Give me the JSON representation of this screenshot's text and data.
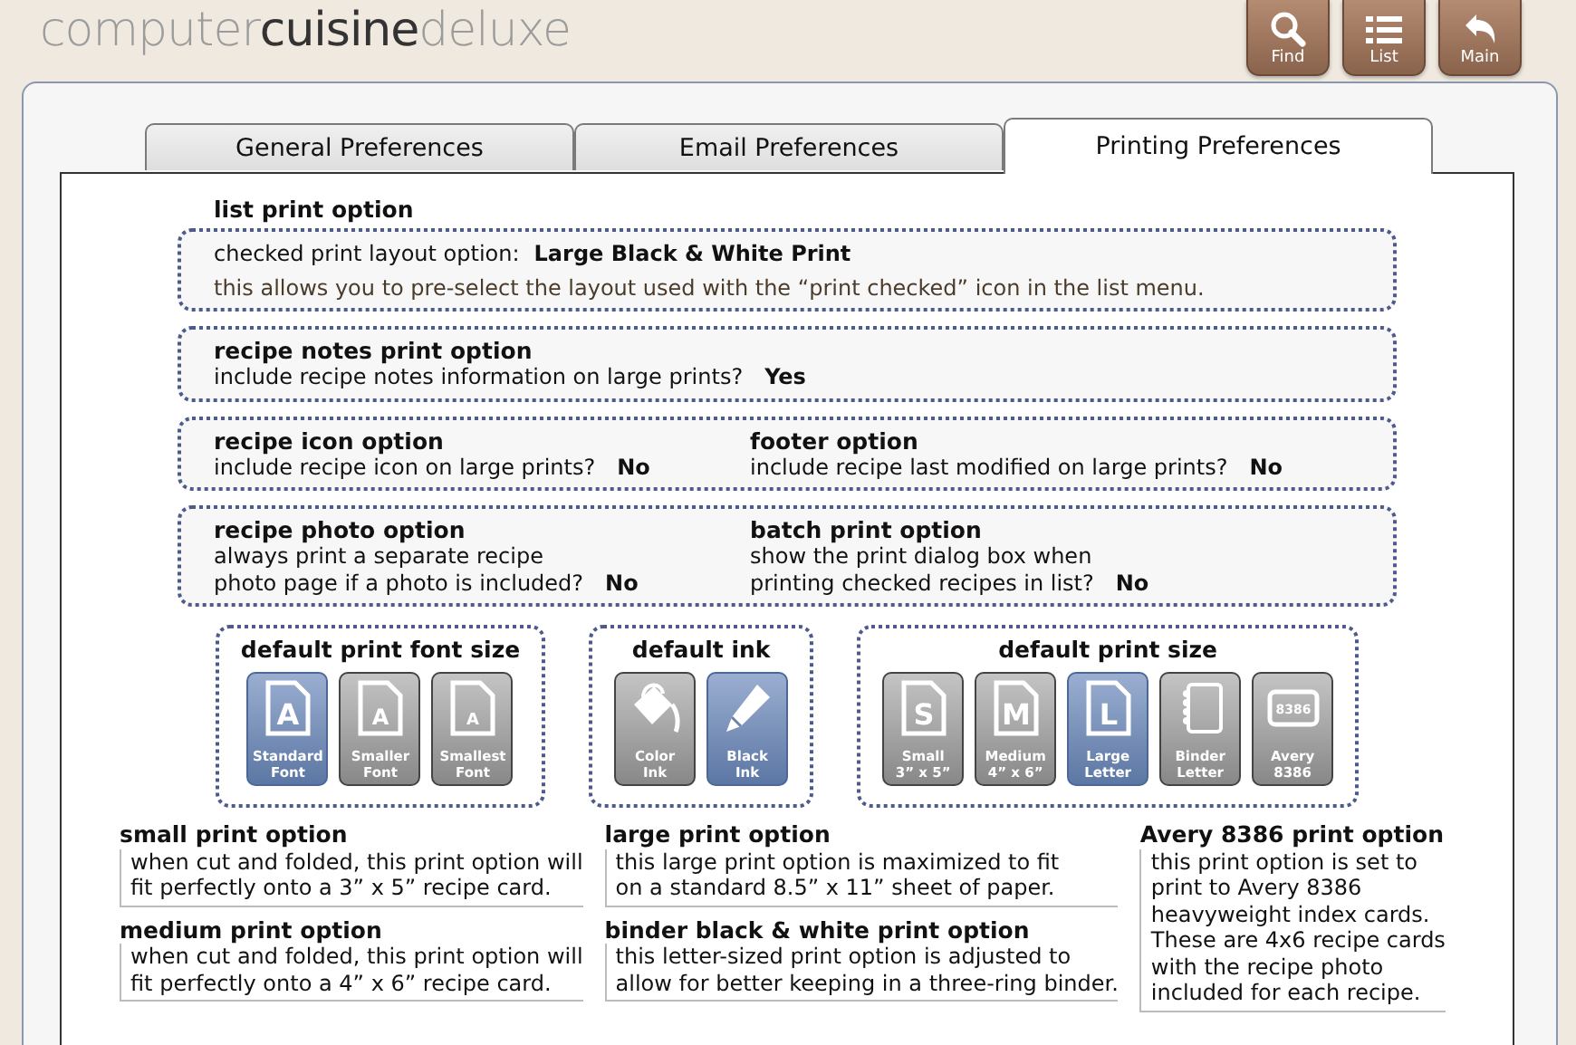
{
  "logo": {
    "part_1": "computer",
    "part_2": "cuisine",
    "part_3": "deluxe"
  },
  "toolbar": [
    {
      "label": "Find",
      "kind": "search"
    },
    {
      "label": "List",
      "kind": "list"
    },
    {
      "label": "Main",
      "kind": "back"
    }
  ],
  "tabs": [
    {
      "label": "General Preferences",
      "selected": false
    },
    {
      "label": "Email Preferences",
      "selected": false
    },
    {
      "label": "Printing Preferences",
      "selected": true
    }
  ],
  "list_print_option": {
    "title": "list print option",
    "setting_label": "checked print layout option:",
    "setting_value": "Large Black & White Print",
    "note": "this allows you to pre-select the layout used with the “print checked” icon in the list menu."
  },
  "option_groups": [
    {
      "options": [
        {
          "title": "recipe notes print option",
          "lines": [
            "include recipe notes information on large prints?"
          ],
          "value": "Yes"
        }
      ]
    },
    {
      "options": [
        {
          "title": "recipe icon option",
          "lines": [
            "include recipe icon on large prints?"
          ],
          "value": "No"
        },
        {
          "title": "footer option",
          "lines": [
            "include recipe last modified on large prints?"
          ],
          "value": "No"
        }
      ]
    },
    {
      "options": [
        {
          "title": "recipe photo option",
          "lines": [
            "always print a separate recipe",
            "photo page if a photo is included?"
          ],
          "value": "No"
        },
        {
          "title": "batch print option",
          "lines": [
            "show the print dialog box when",
            "printing checked recipes in list?"
          ],
          "value": "No"
        }
      ]
    }
  ],
  "choice_groups": [
    {
      "title": "default print font size",
      "choices": [
        {
          "kind": "document",
          "glyph": "A",
          "lines": [
            "Standard",
            "Font"
          ],
          "selected": true
        },
        {
          "kind": "smalldocument",
          "glyph": "A",
          "lines": [
            "Smaller",
            "Font"
          ],
          "selected": false
        },
        {
          "kind": "tinydocument",
          "glyph": "A",
          "lines": [
            "Smallest",
            "Font"
          ],
          "selected": false
        }
      ]
    },
    {
      "title": "default ink",
      "choices": [
        {
          "kind": "bucket",
          "lines": [
            "Color",
            "Ink"
          ],
          "selected": false
        },
        {
          "kind": "pencil",
          "lines": [
            "Black",
            "Ink"
          ],
          "selected": true
        }
      ]
    },
    {
      "title": "default print size",
      "choices": [
        {
          "kind": "document",
          "glyph": "S",
          "lines": [
            "Small",
            "3” x 5”"
          ],
          "selected": false
        },
        {
          "kind": "document",
          "glyph": "M",
          "lines": [
            "Medium",
            "4” x 6”"
          ],
          "selected": false
        },
        {
          "kind": "document",
          "glyph": "L",
          "lines": [
            "Large",
            "Letter"
          ],
          "selected": true
        },
        {
          "kind": "notebook",
          "lines": [
            "Binder",
            "Letter"
          ],
          "selected": false
        },
        {
          "kind": "card",
          "glyph": "8386",
          "lines": [
            "Avery",
            "8386"
          ],
          "selected": false
        }
      ]
    }
  ],
  "descriptions": [
    [
      {
        "title": "small print option",
        "lines": [
          "when cut and folded, this print option will",
          "fit perfectly onto a 3” x 5” recipe card."
        ]
      },
      {
        "title": "medium print option",
        "lines": [
          "when cut and folded, this print option will",
          "fit perfectly onto a 4” x 6” recipe card."
        ]
      }
    ],
    [
      {
        "title": "large print option",
        "lines": [
          "this large print option is maximized to fit",
          "on a standard 8.5” x 11” sheet of paper."
        ]
      },
      {
        "title": "binder black & white print option",
        "lines": [
          "this letter-sized print option is adjusted to",
          "allow for better keeping in a three-ring binder."
        ]
      }
    ],
    [
      {
        "title": "Avery 8386 print option",
        "lines": [
          "this print option is set to",
          "print to Avery 8386",
          "heavyweight index cards.",
          "These are 4x6 recipe cards",
          "with the recipe photo",
          "included for each recipe."
        ]
      }
    ]
  ]
}
